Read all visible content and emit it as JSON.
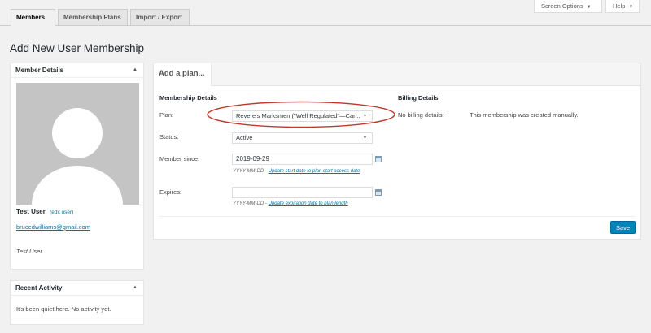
{
  "tabs": [
    {
      "label": "Members"
    },
    {
      "label": "Membership Plans"
    },
    {
      "label": "Import / Export"
    }
  ],
  "top_buttons": {
    "screen_options": "Screen Options",
    "help": "Help"
  },
  "page_title": "Add New User Membership",
  "member_box": {
    "title": "Member Details",
    "name": "Test User",
    "edit_link": "(edit user)",
    "email": "brucedwilliams@gmail.com",
    "display_name": "Test User"
  },
  "activity_box": {
    "title": "Recent Activity",
    "empty_text": "It's been quiet here. No activity yet."
  },
  "plan_panel": {
    "tab_label": "Add a plan...",
    "membership_heading": "Membership Details",
    "billing_heading": "Billing Details",
    "plan_label": "Plan:",
    "plan_value": "Revere's Marksmen (\"Well Regulated\"—Car...",
    "status_label": "Status:",
    "status_value": "Active",
    "member_since_label": "Member since:",
    "member_since_value": "2019-09-29",
    "since_hint_prefix": "YYYY-MM-DD - ",
    "since_hint_link": "Update start date to plan start access date",
    "expires_label": "Expires:",
    "expires_value": "",
    "expires_hint_prefix": "YYYY-MM-DD - ",
    "expires_hint_link": "Update expiration date to plan length",
    "billing_label": "No billing details:",
    "billing_value": "This membership was created manually.",
    "save_label": "Save"
  },
  "colors": {
    "accent": "#0073aa",
    "save_button": "#0085ba",
    "annotation_ellipse": "#c0392b"
  },
  "icons": {
    "calendar": "calendar-icon",
    "dropdown": "chevron-down-icon",
    "collapse": "caret-up-icon"
  }
}
